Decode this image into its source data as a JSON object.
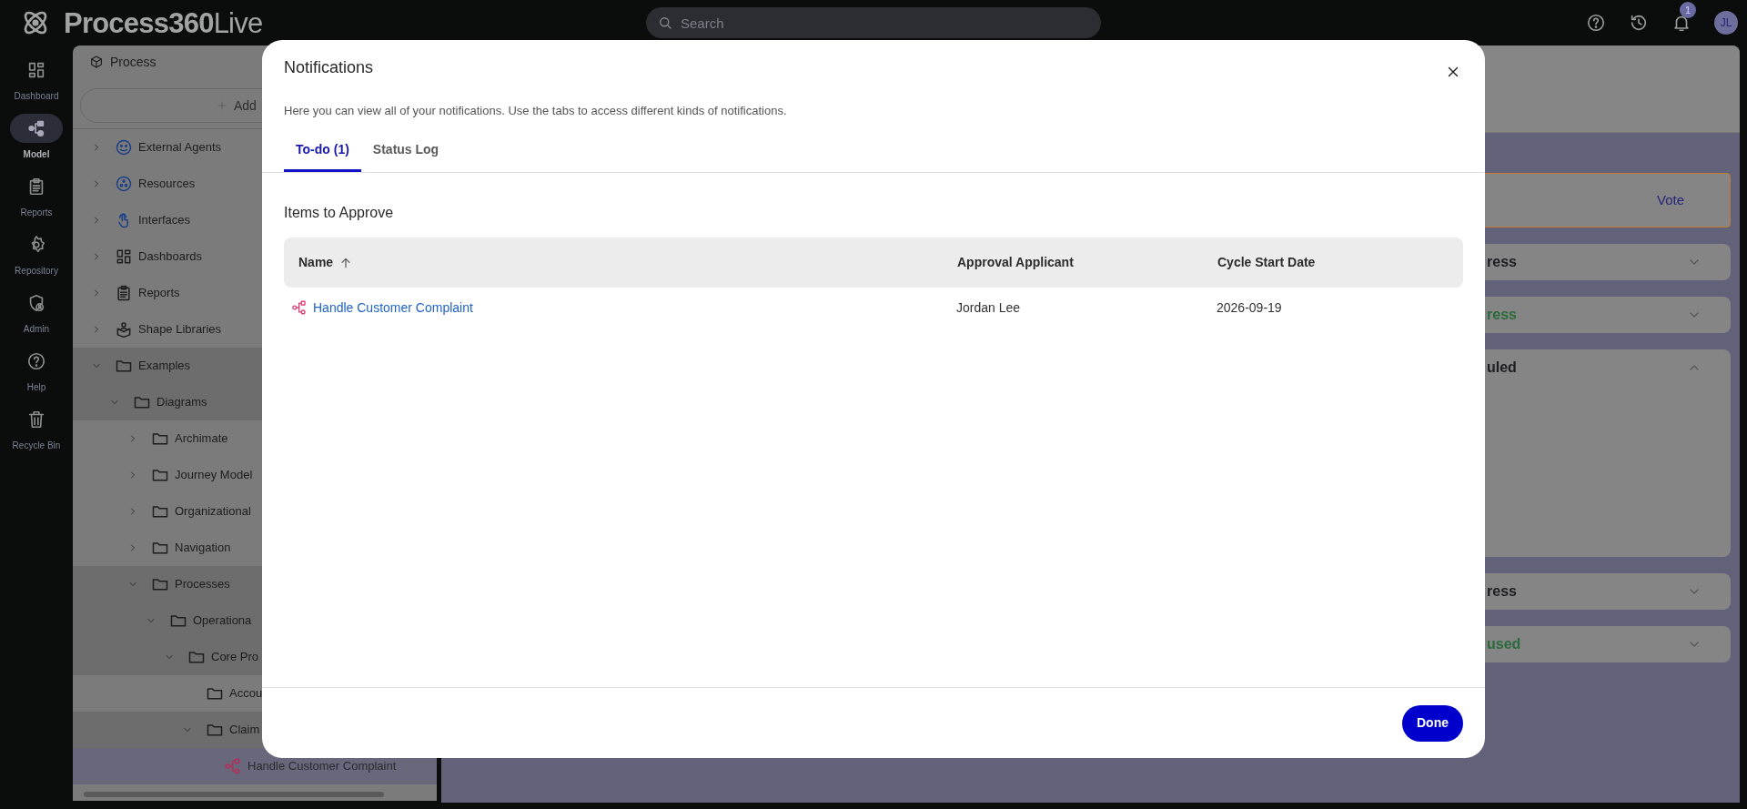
{
  "header": {
    "logo": "**Process360**Live",
    "search": {
      "placeholder": "Search"
    },
    "notification_count": "1",
    "avatar": "JL"
  },
  "rail": {
    "items": [
      {
        "label": "Dashboard",
        "kind": "dashboard",
        "selected": false
      },
      {
        "label": "Model",
        "kind": "model",
        "selected": true
      },
      {
        "label": "Reports",
        "kind": "reports",
        "selected": false
      },
      {
        "label": "Repository",
        "kind": "repository",
        "selected": false
      },
      {
        "label": "Admin",
        "kind": "admin",
        "selected": false
      },
      {
        "label": "Help",
        "kind": "help",
        "selected": false
      },
      {
        "label": "Recycle Bin",
        "kind": "recycle",
        "selected": false
      }
    ]
  },
  "tree": {
    "title": "Process",
    "add_button": "Add",
    "items": [
      {
        "label": "External Agents",
        "kind": "agents",
        "expanded": false,
        "selected": false
      },
      {
        "label": "Resources",
        "kind": "resources",
        "expanded": false,
        "selected": false
      },
      {
        "label": "Interfaces",
        "kind": "interfaces",
        "expanded": false,
        "selected": false
      },
      {
        "label": "Dashboards",
        "kind": "dashboards",
        "expanded": false,
        "selected": false
      },
      {
        "label": "Reports",
        "kind": "reports",
        "expanded": false,
        "selected": false
      },
      {
        "label": "Shape Libraries",
        "kind": "library",
        "expanded": false,
        "selected": false
      },
      {
        "label": "Examples",
        "kind": "folder",
        "expanded": true,
        "selected": false,
        "children": [
          {
            "label": "Diagrams",
            "kind": "folder",
            "expanded": true,
            "selected": false,
            "children": [
              {
                "label": "Archimate",
                "kind": "folder",
                "expanded": false,
                "selected": false
              },
              {
                "label": "Journey Model",
                "kind": "folder",
                "expanded": false,
                "selected": false
              },
              {
                "label": "Organizational",
                "kind": "folder",
                "expanded": false,
                "selected": false
              },
              {
                "label": "Navigation",
                "kind": "folder",
                "expanded": false,
                "selected": false
              },
              {
                "label": "Processes",
                "kind": "folder",
                "expanded": true,
                "selected": false,
                "children": [
                  {
                    "label": "Operationa",
                    "kind": "folder",
                    "expanded": true,
                    "selected": false,
                    "children": [
                      {
                        "label": "Core Pro",
                        "kind": "folder",
                        "expanded": true,
                        "selected": false,
                        "children": [
                          {
                            "label": "Accou",
                            "kind": "folder",
                            "selected": false
                          },
                          {
                            "label": "Claim",
                            "kind": "folder",
                            "expanded": true,
                            "selected": false,
                            "children": [
                              {
                                "label": "Handle Customer Complaint",
                                "kind": "process",
                                "selected": true
                              }
                            ]
                          }
                        ]
                      }
                    ]
                  }
                ]
              }
            ]
          }
        ]
      }
    ]
  },
  "main": {
    "vote_card": {
      "action": "Vote"
    },
    "panels": [
      {
        "title": "ress",
        "color": "#1e1e22",
        "expanded": false
      },
      {
        "title": "ress",
        "color": "#2b6a3c",
        "expanded": false
      },
      {
        "title": "uled",
        "color": "#1e1e22",
        "expanded": true
      },
      {
        "title": "ress",
        "color": "#1e1e22",
        "expanded": false
      },
      {
        "title": "used",
        "color": "#2b6a3c",
        "expanded": false
      }
    ]
  },
  "modal": {
    "title": "Notifications",
    "subtitle": "Here you can view all of your notifications. Use the tabs to access different kinds of notifications.",
    "tabs": [
      {
        "label": "To-do (1)",
        "selected": true
      },
      {
        "label": "Status Log",
        "selected": false
      }
    ],
    "section_title": "Items to Approve",
    "table": {
      "columns": [
        {
          "label": "Name",
          "sorted": true
        },
        {
          "label": "Approval Applicant"
        },
        {
          "label": "Cycle Start Date"
        }
      ],
      "rows": [
        {
          "name": "Handle Customer Complaint",
          "kind": "process",
          "applicant": "Jordan Lee",
          "start_date": "2026-09-19"
        }
      ]
    },
    "done_button": "Done"
  }
}
